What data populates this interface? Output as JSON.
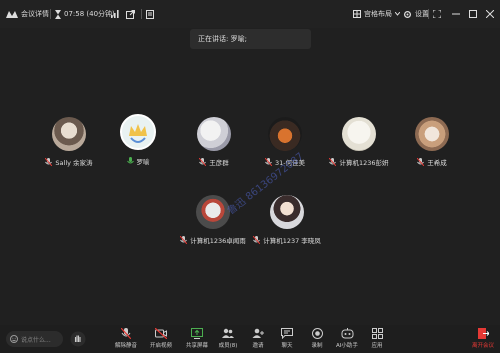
{
  "topbar": {
    "meeting_details": "会议详情",
    "timer": "07:58 (40分钟)",
    "grid_layout": "宫格布局",
    "settings": "设置"
  },
  "speaking_banner": "正在讲话: 罗喻;",
  "participants": [
    {
      "name": "Sally 余家涛",
      "muted": true
    },
    {
      "name": "罗喻",
      "muted": false,
      "active": true
    },
    {
      "name": "王彦群",
      "muted": true
    },
    {
      "name": "31-何佳美",
      "muted": true
    },
    {
      "name": "计算机1236彭妍",
      "muted": true
    },
    {
      "name": "王希成",
      "muted": true
    },
    {
      "name": "计算机1236卓闻雨",
      "muted": true
    },
    {
      "name": "计算机1237 李晓凤",
      "muted": true
    }
  ],
  "bottombar": {
    "chat_placeholder": "说点什么...",
    "controls": [
      "解除静音",
      "开启视频",
      "共享屏幕",
      "成员(8)",
      "邀请",
      "聊天",
      "录制",
      "AI小助手",
      "应用"
    ],
    "leave": "离开会议"
  },
  "watermark": "鲁迅 86136972087",
  "colors": {
    "accent": "#4f7cff",
    "leave": "#e53935",
    "background": "#202020"
  }
}
